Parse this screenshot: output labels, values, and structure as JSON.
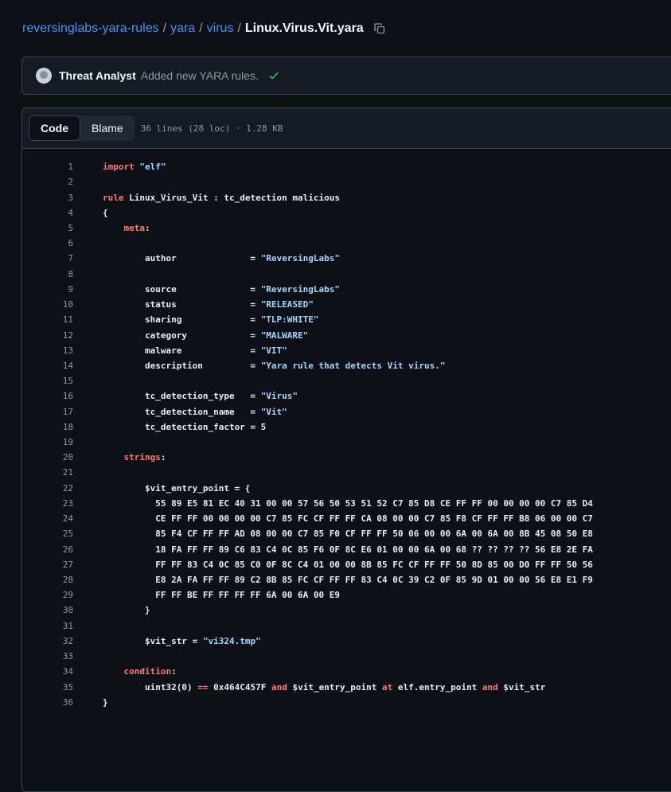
{
  "breadcrumb": {
    "repo": "reversinglabs-yara-rules",
    "sep": "/",
    "folder1": "yara",
    "folder2": "virus",
    "file": "Linux.Virus.Vit.yara"
  },
  "commit": {
    "author": "Threat Analyst",
    "message": "Added new YARA rules."
  },
  "file_header": {
    "tab_code": "Code",
    "tab_blame": "Blame",
    "meta": "36 lines (28 loc) · 1.28 KB"
  },
  "colors": {
    "keyword": "#ff7b72",
    "string": "#a5d6ff",
    "link": "#4493f8",
    "success": "#3fb950"
  },
  "code_lines": [
    [
      [
        "kw",
        "import "
      ],
      [
        "str",
        "\"elf\""
      ]
    ],
    [],
    [
      [
        "kw",
        "rule "
      ],
      [
        "id",
        "Linux_Virus_Vit : tc_detection malicious"
      ]
    ],
    [
      [
        "id",
        "{"
      ]
    ],
    [
      [
        "id",
        "    "
      ],
      [
        "kw",
        "meta"
      ],
      [
        "id",
        ":"
      ]
    ],
    [],
    [
      [
        "id",
        "        author              = "
      ],
      [
        "str",
        "\"ReversingLabs\""
      ]
    ],
    [],
    [
      [
        "id",
        "        source              = "
      ],
      [
        "str",
        "\"ReversingLabs\""
      ]
    ],
    [
      [
        "id",
        "        status              = "
      ],
      [
        "str",
        "\"RELEASED\""
      ]
    ],
    [
      [
        "id",
        "        sharing             = "
      ],
      [
        "str",
        "\"TLP:WHITE\""
      ]
    ],
    [
      [
        "id",
        "        category            = "
      ],
      [
        "str",
        "\"MALWARE\""
      ]
    ],
    [
      [
        "id",
        "        malware             = "
      ],
      [
        "str",
        "\"VIT\""
      ]
    ],
    [
      [
        "id",
        "        description         = "
      ],
      [
        "str",
        "\"Yara rule that detects Vit virus.\""
      ]
    ],
    [],
    [
      [
        "id",
        "        tc_detection_type   = "
      ],
      [
        "str",
        "\"Virus\""
      ]
    ],
    [
      [
        "id",
        "        tc_detection_name   = "
      ],
      [
        "str",
        "\"Vit\""
      ]
    ],
    [
      [
        "id",
        "        tc_detection_factor = 5"
      ]
    ],
    [],
    [
      [
        "id",
        "    "
      ],
      [
        "kw",
        "strings"
      ],
      [
        "id",
        ":"
      ]
    ],
    [],
    [
      [
        "id",
        "        $vit_entry_point = {"
      ]
    ],
    [
      [
        "id",
        "          55 89 E5 81 EC 40 31 00 00 57 56 50 53 51 52 C7 85 D8 CE FF FF 00 00 00 00 C7 85 D4"
      ]
    ],
    [
      [
        "id",
        "          CE FF FF 00 00 00 00 C7 85 FC CF FF FF CA 08 00 00 C7 85 F8 CF FF FF B8 06 00 00 C7"
      ]
    ],
    [
      [
        "id",
        "          85 F4 CF FF FF AD 08 00 00 C7 85 F0 CF FF FF 50 06 00 00 6A 00 6A 00 8B 45 08 50 E8"
      ]
    ],
    [
      [
        "id",
        "          18 FA FF FF 89 C6 83 C4 0C 85 F6 0F 8C E6 01 00 00 6A 00 68 ?? ?? ?? ?? 56 E8 2E FA"
      ]
    ],
    [
      [
        "id",
        "          FF FF 83 C4 0C 85 C0 0F 8C C4 01 00 00 8B 85 FC CF FF FF 50 8D 85 00 D0 FF FF 50 56"
      ]
    ],
    [
      [
        "id",
        "          E8 2A FA FF FF 89 C2 8B 85 FC CF FF FF 83 C4 0C 39 C2 0F 85 9D 01 00 00 56 E8 E1 F9"
      ]
    ],
    [
      [
        "id",
        "          FF FF BE FF FF FF FF 6A 00 6A 00 E9"
      ]
    ],
    [
      [
        "id",
        "        }"
      ]
    ],
    [],
    [
      [
        "id",
        "        $vit_str = "
      ],
      [
        "str",
        "\"vi324.tmp\""
      ]
    ],
    [],
    [
      [
        "id",
        "    "
      ],
      [
        "kw",
        "condition"
      ],
      [
        "id",
        ":"
      ]
    ],
    [
      [
        "id",
        "        uint32(0) "
      ],
      [
        "kw",
        "=="
      ],
      [
        "id",
        " 0x464C457F "
      ],
      [
        "kw",
        "and"
      ],
      [
        "id",
        " $vit_entry_point "
      ],
      [
        "kw",
        "at"
      ],
      [
        "id",
        " elf.entry_point "
      ],
      [
        "kw",
        "and"
      ],
      [
        "id",
        " $vit_str"
      ]
    ],
    [
      [
        "id",
        "}"
      ]
    ]
  ]
}
